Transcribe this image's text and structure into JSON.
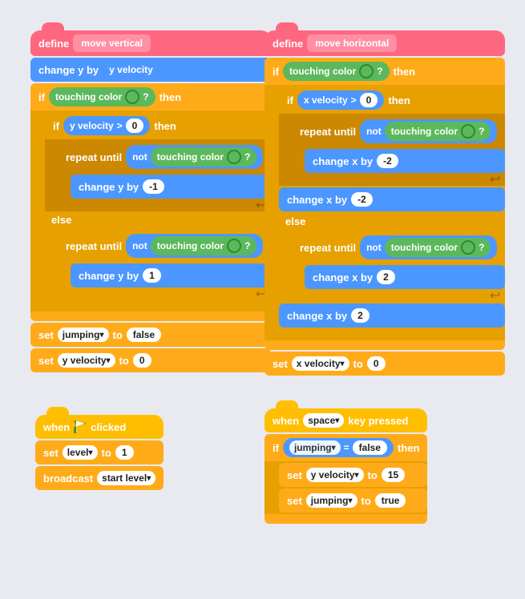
{
  "left_define": {
    "label": "define",
    "name": "move vertical"
  },
  "right_define": {
    "label": "define",
    "name": "move horizontal"
  },
  "blocks": {
    "change_y_by": "change y by",
    "y_velocity": "y velocity",
    "if_label": "if",
    "touching_color": "touching color",
    "then": "then",
    "y_velocity_label": "y velocity",
    "greater": ">",
    "zero": "0",
    "repeat_until": "repeat until",
    "not": "not",
    "change_y_by_neg1": "-1",
    "change_y_by_1": "1",
    "else": "else",
    "set": "set",
    "jumping_var": "jumping",
    "to": "to",
    "false_val": "false",
    "true_val": "true",
    "y_vel_var": "y velocity",
    "zero2": "0",
    "when_clicked": "when",
    "clicked": "clicked",
    "level_var": "level",
    "to1": "1",
    "broadcast": "broadcast",
    "start_level": "start level",
    "when_space": "when",
    "space_key": "space",
    "key_pressed": "key pressed",
    "jumping_eq": "jumping",
    "equals": "=",
    "false2": "false",
    "y_vel_15": "15",
    "x_velocity": "x velocity",
    "change_x_by": "change x by",
    "neg2": "-2",
    "pos2": "2",
    "x_vel_var": "x velocity"
  }
}
